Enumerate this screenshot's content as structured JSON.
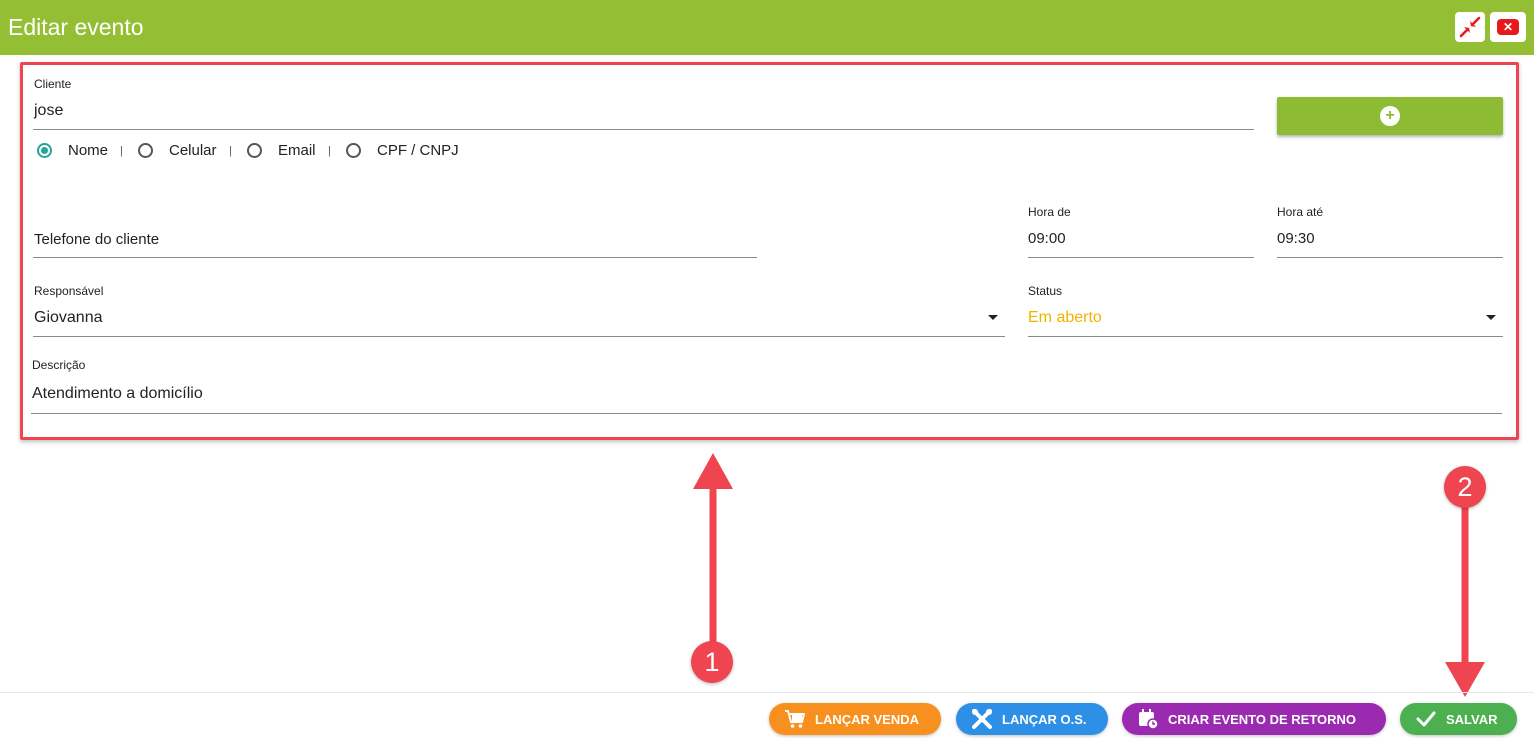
{
  "window": {
    "title": "Editar evento",
    "minimize_icon": "compress-arrows-icon",
    "close_icon": "close-x-icon"
  },
  "form": {
    "cliente": {
      "label": "Cliente",
      "value": "jose"
    },
    "search_by": {
      "options": [
        "Nome",
        "Celular",
        "Email",
        "CPF / CNPJ"
      ],
      "separator": "|",
      "selected": "Nome"
    },
    "add_client_icon": "plus-circle-icon",
    "telefone": {
      "placeholder": "Telefone do cliente",
      "value": ""
    },
    "hora_de": {
      "label": "Hora de",
      "value": "09:00"
    },
    "hora_ate": {
      "label": "Hora até",
      "value": "09:30"
    },
    "responsavel": {
      "label": "Responsável",
      "value": "Giovanna"
    },
    "status": {
      "label": "Status",
      "value": "Em aberto",
      "color": "#f0b400"
    },
    "descricao": {
      "label": "Descrição",
      "value": "Atendimento a domicílio"
    }
  },
  "footer": {
    "lancar_venda": {
      "label": "LANÇAR VENDA",
      "color": "#f7901e",
      "icon": "cart-icon"
    },
    "lancar_os": {
      "label": "LANÇAR O.S.",
      "color": "#2d8fe6",
      "icon": "tools-icon"
    },
    "criar_evento": {
      "label": "CRIAR EVENTO DE RETORNO",
      "color": "#9a2bb0",
      "icon": "calendar-clock-icon"
    },
    "salvar": {
      "label": "SALVAR",
      "color": "#4caf50",
      "icon": "check-icon"
    }
  },
  "annotations": {
    "marker_1": "1",
    "marker_2": "2",
    "color": "#ef4550"
  }
}
